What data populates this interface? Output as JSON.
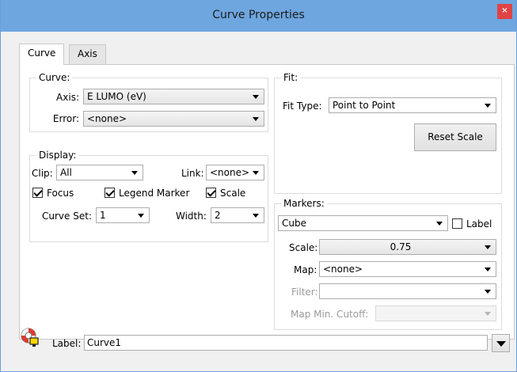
{
  "window": {
    "title": "Curve Properties",
    "close_glyph": "×"
  },
  "tabs": [
    {
      "label": "Curve",
      "active": true
    },
    {
      "label": "Axis",
      "active": false
    }
  ],
  "curve_group": {
    "title": "Curve:",
    "axis_label": "Axis:",
    "axis_value": "E LUMO (eV)",
    "error_label": "Error:",
    "error_value": "<none>"
  },
  "display_group": {
    "title": "Display:",
    "clip_label": "Clip:",
    "clip_value": "All",
    "link_label": "Link:",
    "link_value": "<none>",
    "focus_label": "Focus",
    "focus_checked": true,
    "legend_marker_label": "Legend Marker",
    "legend_marker_checked": true,
    "scale_label": "Scale",
    "scale_checked": true,
    "curve_set_label": "Curve Set:",
    "curve_set_value": "1",
    "width_label": "Width:",
    "width_value": "2"
  },
  "fit_group": {
    "title": "Fit:",
    "fit_type_label": "Fit Type:",
    "fit_type_value": "Point to Point",
    "reset_scale_label": "Reset Scale"
  },
  "markers_group": {
    "title": "Markers:",
    "marker_value": "Cube",
    "label_checkbox": "Label",
    "label_checked": false,
    "scale_label": "Scale:",
    "scale_value": "0.75",
    "map_label": "Map:",
    "map_value": "<none>",
    "filter_label": "Filter:",
    "filter_value": "",
    "map_min_cutoff_label": "Map Min. Cutoff:",
    "map_min_cutoff_value": ""
  },
  "footer": {
    "label": "Label:",
    "label_value": "Curve1"
  },
  "colors": {
    "titlebar": "#6ea6df",
    "close": "#e04343",
    "window_bg": "#f0f0f0"
  },
  "icons": {
    "help": "lifebuoy-icon",
    "dropdown": "triangle-down-icon"
  }
}
